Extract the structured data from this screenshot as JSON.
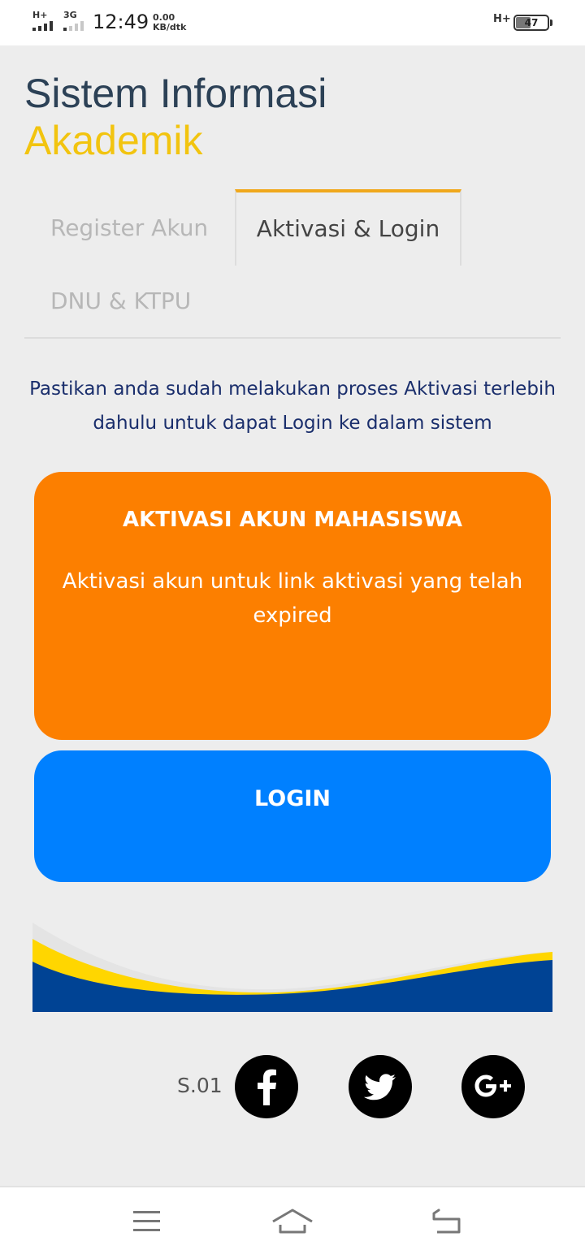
{
  "status_bar": {
    "net1": "H+",
    "net2": "3G",
    "time": "12:49",
    "speed_value": "0.00",
    "speed_unit": "KB/dtk",
    "net_right": "H+",
    "battery": "47"
  },
  "header": {
    "title_line1": "Sistem Informasi",
    "title_line2": "Akademik"
  },
  "tabs": [
    {
      "label": "Register Akun",
      "active": false
    },
    {
      "label": "Aktivasi & Login",
      "active": true
    },
    {
      "label": "DNU & KTPU",
      "active": false
    }
  ],
  "intro_text": "Pastikan anda sudah melakukan proses Aktivasi terlebih dahulu untuk dapat Login ke dalam sistem",
  "activation_card": {
    "title": "AKTIVASI AKUN MAHASISWA",
    "description": "Aktivasi akun untuk link aktivasi yang telah expired",
    "color": "#fc7f00"
  },
  "login_card": {
    "title": "LOGIN",
    "color": "#0080ff"
  },
  "footer": {
    "version": "S.01",
    "social_icons": [
      "facebook-icon",
      "twitter-icon",
      "google-plus-icon"
    ]
  },
  "nav_bar": {
    "icons": [
      "menu-icon",
      "home-icon",
      "back-icon"
    ]
  },
  "colors": {
    "title_dark": "#2c4156",
    "title_accent": "#f2c40f",
    "tab_accent": "#f0a81c",
    "wave_blue": "#004394",
    "wave_yellow": "#ffd600"
  }
}
